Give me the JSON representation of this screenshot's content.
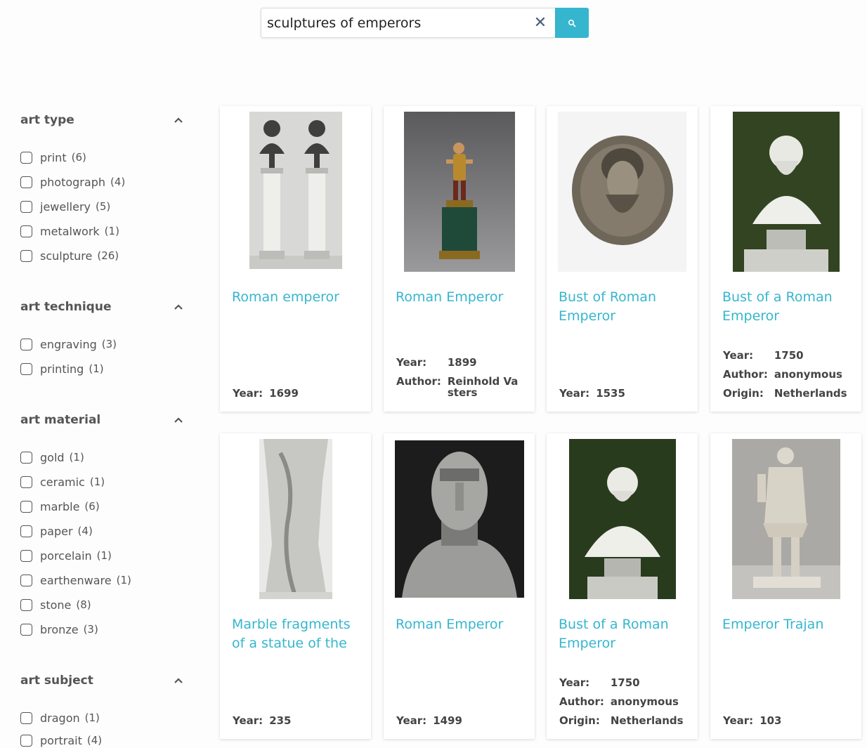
{
  "search": {
    "value": "sculptures of emperors",
    "clear_symbol": "✕"
  },
  "facets": [
    {
      "title": "art type",
      "options": [
        {
          "label": "print",
          "count": "(6)"
        },
        {
          "label": "photograph",
          "count": "(4)"
        },
        {
          "label": "jewellery",
          "count": "(5)"
        },
        {
          "label": "metalwork",
          "count": "(1)"
        },
        {
          "label": "sculpture",
          "count": "(26)"
        }
      ]
    },
    {
      "title": "art technique",
      "options": [
        {
          "label": "engraving",
          "count": "(3)"
        },
        {
          "label": "printing",
          "count": "(1)"
        }
      ]
    },
    {
      "title": "art material",
      "options": [
        {
          "label": "gold",
          "count": "(1)"
        },
        {
          "label": "ceramic",
          "count": "(1)"
        },
        {
          "label": "marble",
          "count": "(6)"
        },
        {
          "label": "paper",
          "count": "(4)"
        },
        {
          "label": "porcelain",
          "count": "(1)"
        },
        {
          "label": "earthenware",
          "count": "(1)"
        },
        {
          "label": "stone",
          "count": "(8)"
        },
        {
          "label": "bronze",
          "count": "(3)"
        }
      ]
    },
    {
      "title": "art subject",
      "options": [
        {
          "label": "dragon",
          "count": "(1)"
        },
        {
          "label": "portrait",
          "count": "(4)"
        }
      ]
    }
  ],
  "labels": {
    "year": "Year:",
    "author": "Author:",
    "origin": "Origin:"
  },
  "results": [
    {
      "title": "Roman emperor",
      "year": "1699"
    },
    {
      "title": "Roman Emperor",
      "year": "1899",
      "author": "Reinhold Vasters"
    },
    {
      "title": "Bust of Roman Emperor",
      "year": "1535"
    },
    {
      "title": "Bust of a Roman Emperor",
      "year": "1750",
      "author": "anonymous",
      "origin": "Netherlands"
    },
    {
      "title": "Marble fragments of a statue of the",
      "year": "235"
    },
    {
      "title": "Roman Emperor",
      "year": "1499"
    },
    {
      "title": "Bust of a Roman Emperor",
      "year": "1750",
      "author": "anonymous",
      "origin": "Netherlands"
    },
    {
      "title": "Emperor Trajan",
      "year": "103"
    }
  ],
  "colors": {
    "accent": "#36b6ce",
    "clear": "#4a5a7a"
  }
}
